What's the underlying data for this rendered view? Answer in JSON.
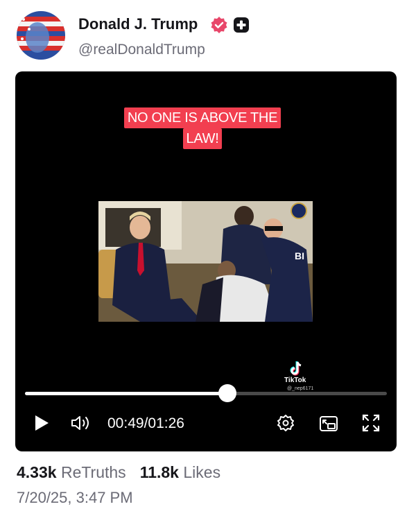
{
  "author": {
    "name": "Donald J. Trump",
    "handle": "@realDonaldTrump",
    "badge_icon": "verified-icon",
    "badge_color": "#e8476a",
    "extra_icon": "plus-badge-icon"
  },
  "video": {
    "caption_lines": [
      "NO ONE IS ABOVE THE",
      "LAW!"
    ],
    "caption_bg": "#f23f50",
    "watermark": {
      "label": "TikTok",
      "user": "@_nep6171"
    },
    "progress": 0.56,
    "current_time": "00:49",
    "duration": "01:26",
    "controls": [
      "play-icon",
      "volume-icon",
      "settings-icon",
      "pip-icon",
      "fullscreen-icon"
    ]
  },
  "stats": {
    "retruths_count": "4.33k",
    "retruths_label": "ReTruths",
    "likes_count": "11.8k",
    "likes_label": "Likes"
  },
  "timestamp": "7/20/25, 3:47 PM"
}
